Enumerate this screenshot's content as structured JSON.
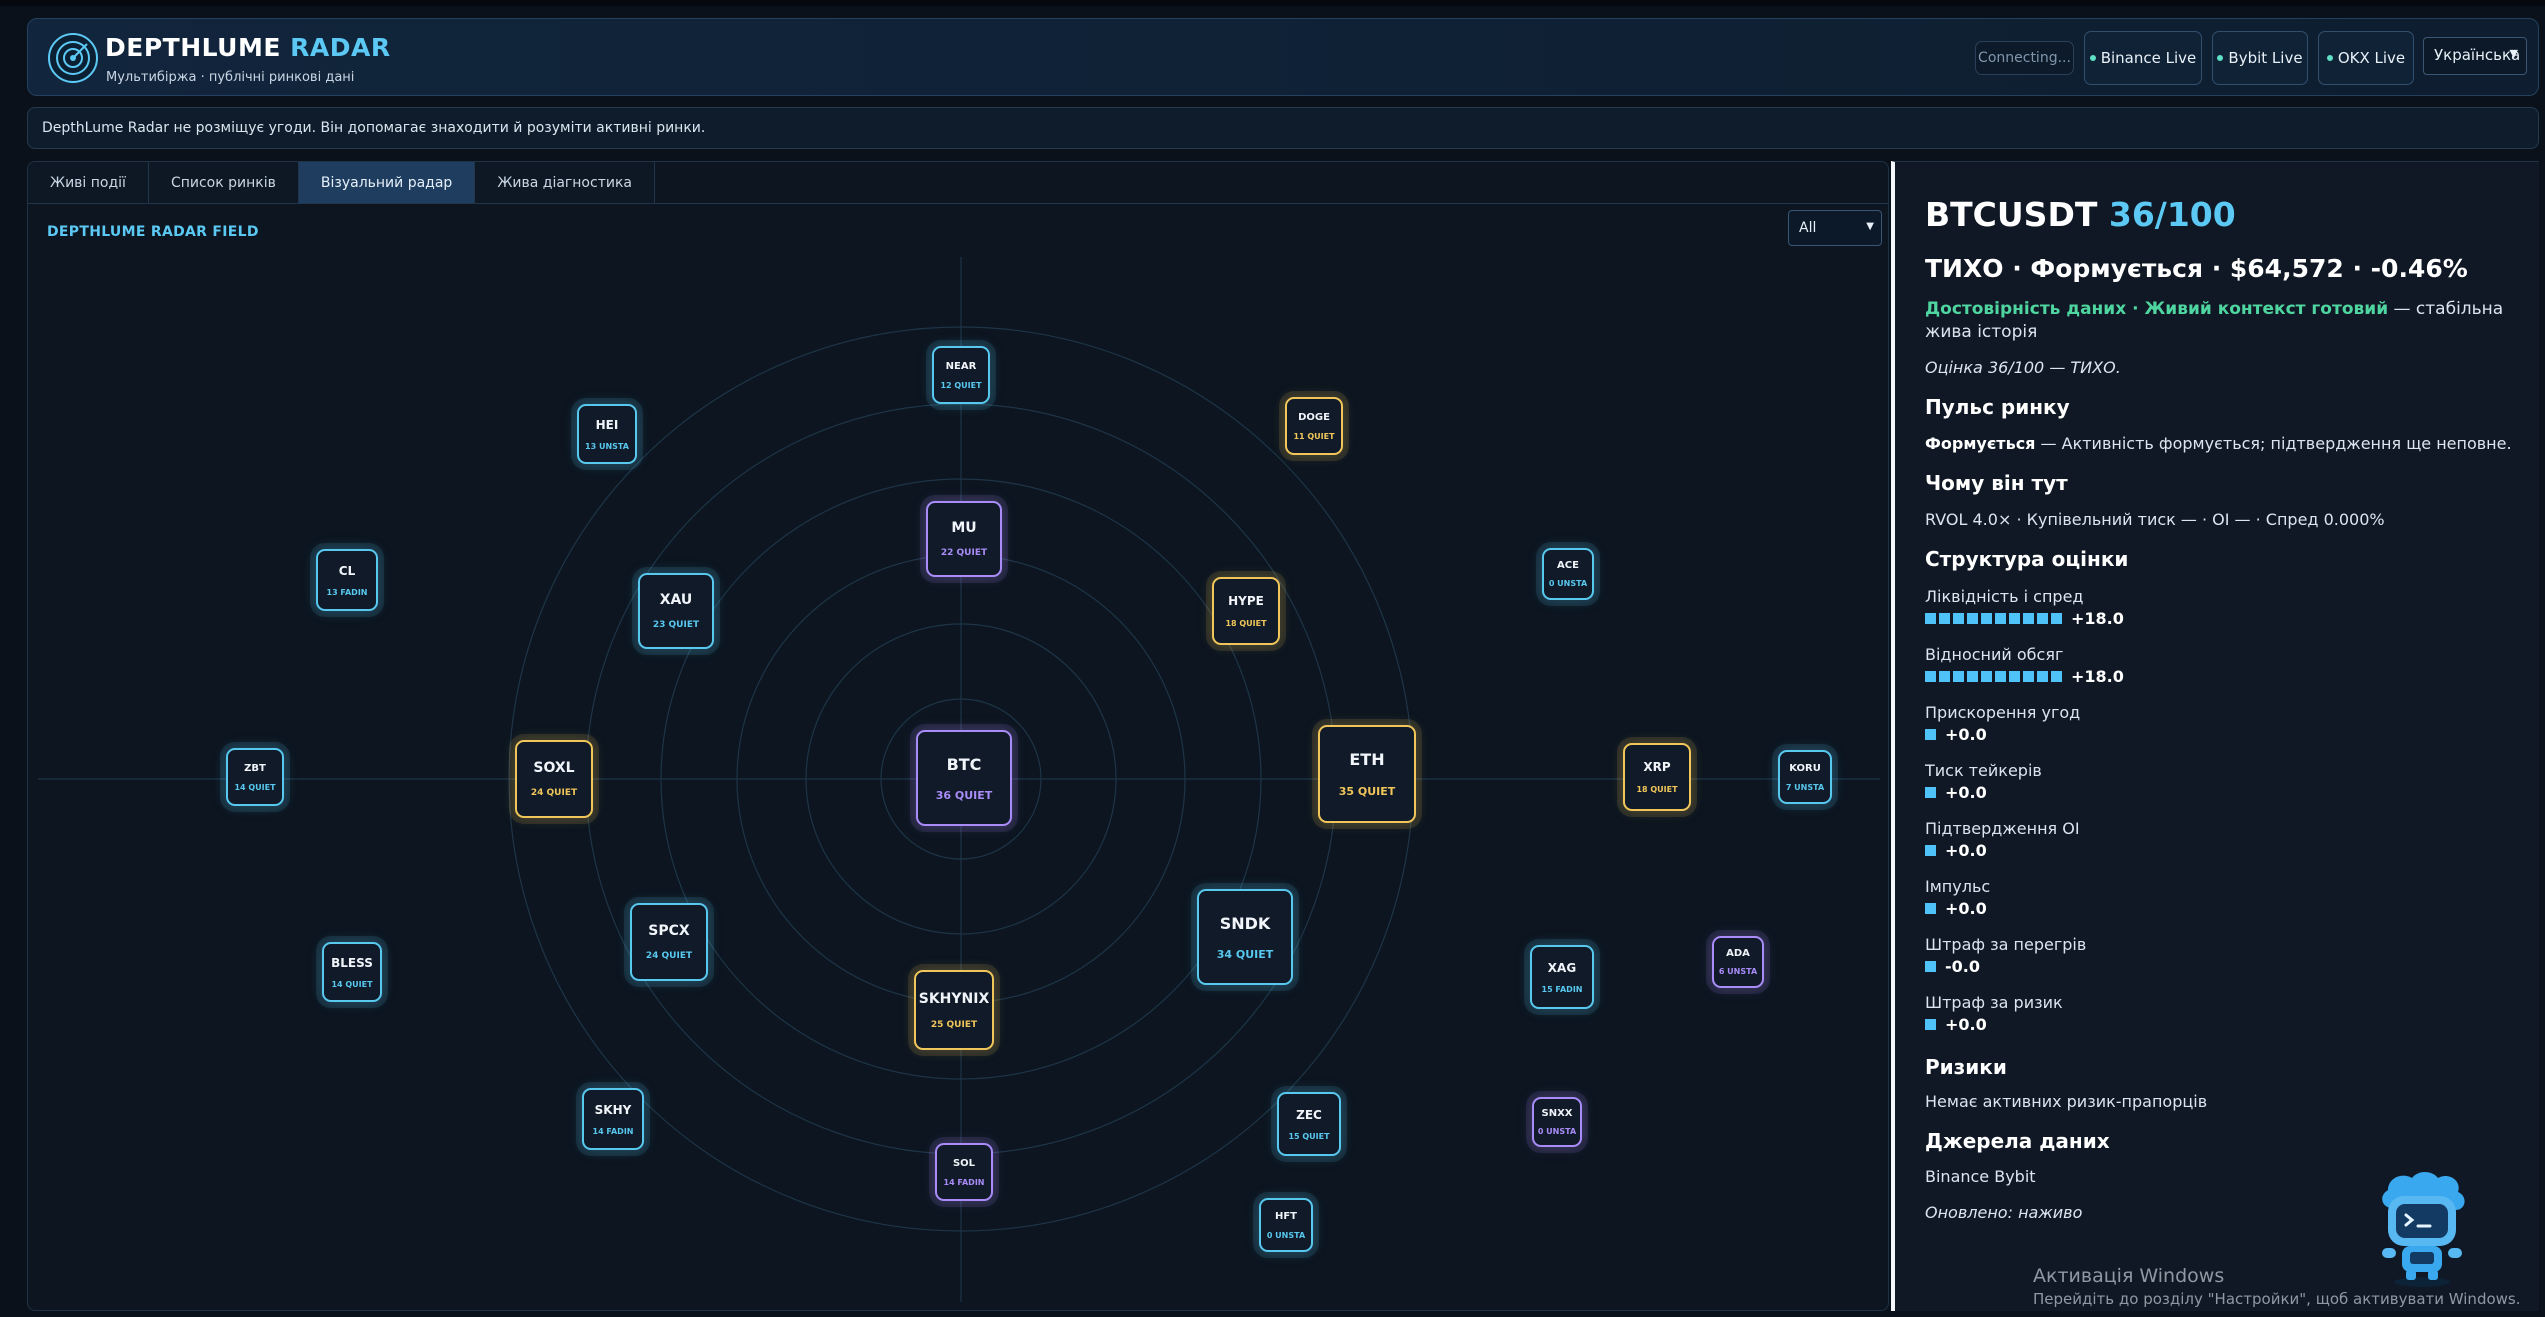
{
  "header": {
    "brand_main": "DEPTHLUME",
    "brand_accent": "RADAR",
    "subtitle": "Мультибіржа · публічні ринкові дані",
    "connecting": "Connecting...",
    "feeds": [
      {
        "label": "Binance Live",
        "status_color": "#5ee0c4"
      },
      {
        "label": "Bybit Live",
        "status_color": "#5ee0c4"
      },
      {
        "label": "OKX Live",
        "status_color": "#5ee0c4"
      }
    ],
    "language": "Українська"
  },
  "notice": "DepthLume Radar не розміщує угоди. Він допомагає знаходити й розуміти активні ринки.",
  "tabs": [
    "Живі події",
    "Список ринків",
    "Візуальний радар",
    "Жива діагностика"
  ],
  "active_tab": "Візуальний радар",
  "radar": {
    "title": "DEPTHLUME RADAR FIELD",
    "filter": "All",
    "colors": {
      "cyan": "#58c8ee",
      "gold": "#f0c65a",
      "purple": "#a98cf7"
    },
    "nodes": [
      {
        "symbol": "BTC",
        "score": "36 QUIET",
        "color": "purple"
      },
      {
        "symbol": "ETH",
        "score": "35 QUIET",
        "color": "gold"
      },
      {
        "symbol": "SNDK",
        "score": "34 QUIET",
        "color": "cyan"
      },
      {
        "symbol": "SKHYNIX",
        "score": "25 QUIET",
        "color": "gold"
      },
      {
        "symbol": "SOXL",
        "score": "24 QUIET",
        "color": "gold"
      },
      {
        "symbol": "SPCX",
        "score": "24 QUIET",
        "color": "cyan"
      },
      {
        "symbol": "XAU",
        "score": "23 QUIET",
        "color": "cyan"
      },
      {
        "symbol": "MU",
        "score": "22 QUIET",
        "color": "purple"
      },
      {
        "symbol": "HYPE",
        "score": "18 QUIET",
        "color": "gold"
      },
      {
        "symbol": "XRP",
        "score": "18 QUIET",
        "color": "gold"
      },
      {
        "symbol": "NEAR",
        "score": "12 QUIET",
        "color": "cyan"
      },
      {
        "symbol": "DOGE",
        "score": "11 QUIET",
        "color": "gold"
      },
      {
        "symbol": "HEI",
        "score": "13 UNSTA",
        "color": "cyan"
      },
      {
        "symbol": "CL",
        "score": "13 FADIN",
        "color": "cyan"
      },
      {
        "symbol": "ACE",
        "score": "0 UNSTA",
        "color": "cyan"
      },
      {
        "symbol": "ZBT",
        "score": "14 QUIET",
        "color": "cyan"
      },
      {
        "symbol": "KORU",
        "score": "7 UNSTA",
        "color": "cyan"
      },
      {
        "symbol": "BLESS",
        "score": "14 QUIET",
        "color": "cyan"
      },
      {
        "symbol": "XAG",
        "score": "15 FADIN",
        "color": "cyan"
      },
      {
        "symbol": "ADA",
        "score": "6 UNSTA",
        "color": "purple"
      },
      {
        "symbol": "SKHY",
        "score": "14 FADIN",
        "color": "cyan"
      },
      {
        "symbol": "ZEC",
        "score": "15 QUIET",
        "color": "cyan"
      },
      {
        "symbol": "SNXX",
        "score": "0 UNSTA",
        "color": "purple"
      },
      {
        "symbol": "SOL",
        "score": "14 FADIN",
        "color": "purple"
      },
      {
        "symbol": "HFT",
        "score": "0 UNSTA",
        "color": "cyan"
      }
    ]
  },
  "detail": {
    "symbol": "BTCUSDT",
    "score": "36/100",
    "state_line": "ТИХО · Формується · $64,572 · -0.46%",
    "trust_highlight": "Достовірність даних · Живий контекст готовий",
    "trust_rest": " — стабільна жива історія",
    "rating": "Оцінка 36/100 — ТИХО.",
    "pulse_heading": "Пульс ринку",
    "pulse_bold": "Формується",
    "pulse_rest": " — Активність формується; підтвердження ще неповне.",
    "why_heading": "Чому він тут",
    "why_text": "RVOL 4.0× · Купівельний тиск — · OI — · Спред 0.000%",
    "structure_heading": "Структура оцінки",
    "structure": [
      {
        "label": "Ліквідність і спред",
        "value": "+18.0",
        "blocks": 10
      },
      {
        "label": "Відносний обсяг",
        "value": "+18.0",
        "blocks": 10
      },
      {
        "label": "Прискорення угод",
        "value": "+0.0",
        "blocks": 1
      },
      {
        "label": "Тиск тейкерів",
        "value": "+0.0",
        "blocks": 1
      },
      {
        "label": "Підтвердження OI",
        "value": "+0.0",
        "blocks": 1
      },
      {
        "label": "Імпульс",
        "value": "+0.0",
        "blocks": 1
      },
      {
        "label": "Штраф за перегрів",
        "value": "-0.0",
        "blocks": 1
      },
      {
        "label": "Штраф за ризик",
        "value": "+0.0",
        "blocks": 1
      }
    ],
    "risks_heading": "Ризики",
    "risks_text": "Немає активних ризик-прапорців",
    "sources_heading": "Джерела даних",
    "sources_text": "Binance Bybit",
    "updated": "Оновлено: наживо"
  },
  "windows_activation": {
    "line1": "Активація Windows",
    "line2": "Перейдіть до розділу \"Настройки\", щоб активувати Windows."
  }
}
